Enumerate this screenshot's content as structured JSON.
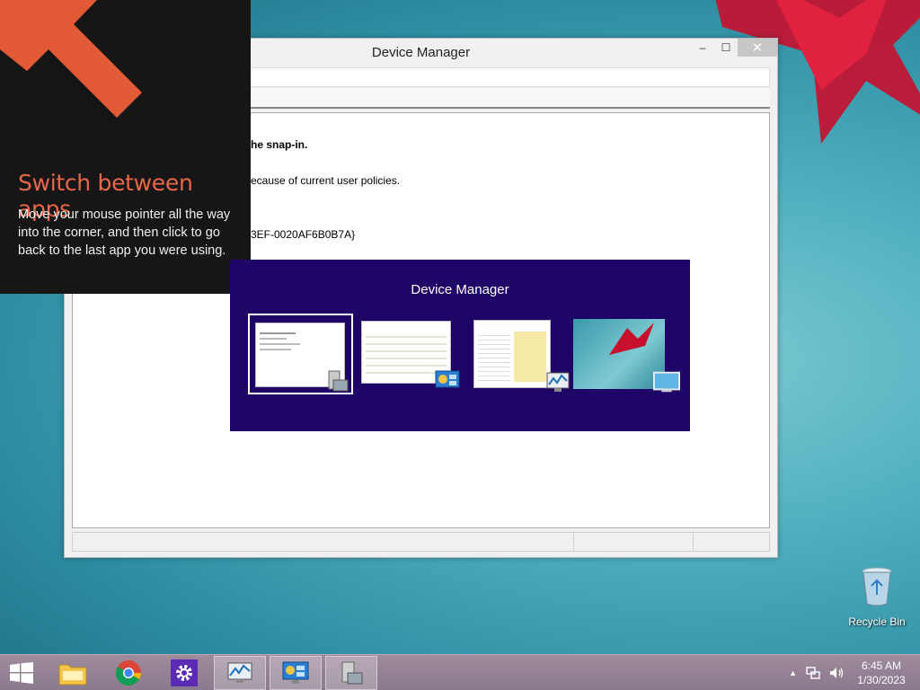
{
  "window": {
    "title": "Device Manager",
    "minimize": "–",
    "maximize": "☐",
    "close": "✕",
    "content_lines": [
      "he snap-in.",
      "ecause of current user policies.",
      "3EF-0020AF6B0B7A}"
    ]
  },
  "tip": {
    "title": "Switch between apps",
    "body": "Move your mouse pointer all the way into the corner, and then click to go back to the last app you were using."
  },
  "switcher": {
    "title": "Device Manager",
    "thumbnails": [
      "Device Manager",
      "Control Panel",
      "Task Manager",
      "Desktop"
    ]
  },
  "desktop": {
    "recycle_bin": "Recycle Bin"
  },
  "taskbar": {
    "items": [
      "File Explorer",
      "Google Chrome",
      "Settings",
      "Performance Monitor",
      "Control Panel",
      "Device Manager"
    ],
    "tray_chevron": "▲",
    "time": "6:45 AM",
    "date": "1/30/2023"
  },
  "colors": {
    "tip_accent": "#e8674a",
    "switcher_bg": "#1f0467",
    "taskbar": "#8b7a8d"
  }
}
